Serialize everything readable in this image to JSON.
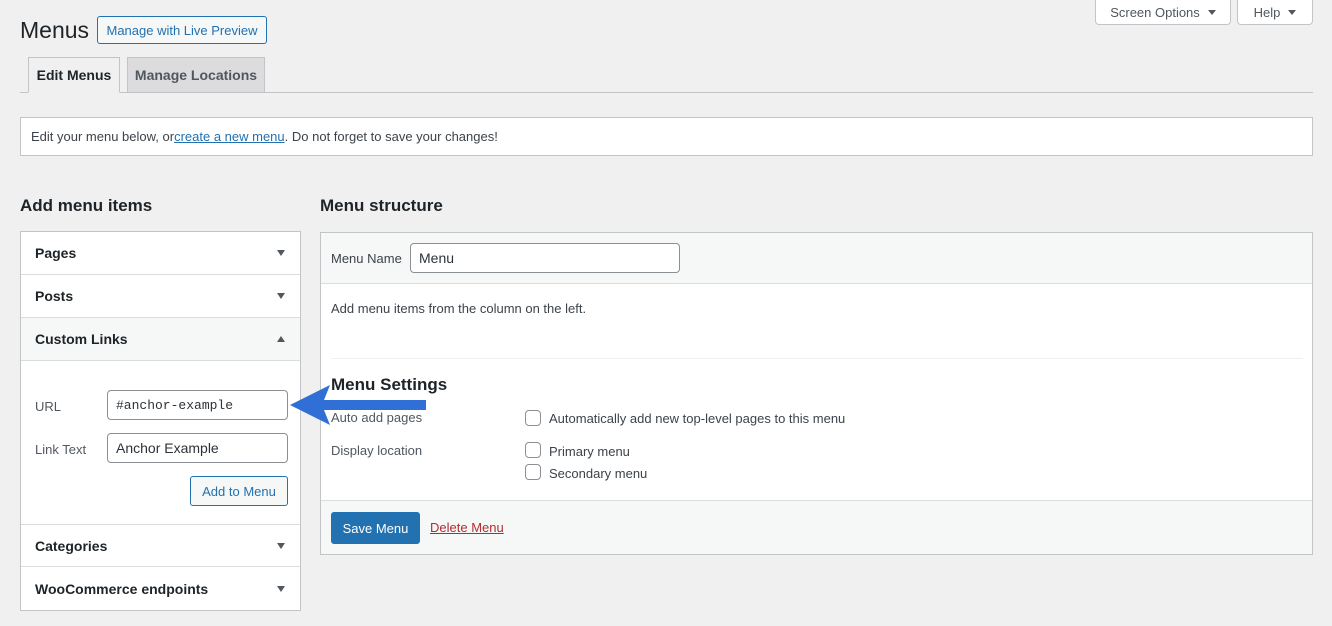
{
  "screen_meta": {
    "screen_options": "Screen Options",
    "help": "Help"
  },
  "header": {
    "title": "Menus",
    "live_preview_button": "Manage with Live Preview"
  },
  "tabs": [
    {
      "label": "Edit Menus",
      "active": true
    },
    {
      "label": "Manage Locations",
      "active": false
    }
  ],
  "notice": {
    "before": "Edit your menu below, or ",
    "link": "create a new menu",
    "after": ". Do not forget to save your changes!"
  },
  "add_items": {
    "heading": "Add menu items",
    "sections": {
      "pages": "Pages",
      "posts": "Posts",
      "custom_links": "Custom Links",
      "categories": "Categories",
      "woocommerce": "WooCommerce endpoints"
    },
    "custom_links_form": {
      "url_label": "URL",
      "url_value": "#anchor-example",
      "link_text_label": "Link Text",
      "link_text_value": "Anchor Example",
      "add_button": "Add to Menu"
    }
  },
  "structure": {
    "heading": "Menu structure",
    "menu_name_label": "Menu Name",
    "menu_name_value": "Menu",
    "empty_text": "Add menu items from the column on the left.",
    "settings_heading": "Menu Settings",
    "auto_add_label": "Auto add pages",
    "auto_add_option": "Automatically add new top-level pages to this menu",
    "display_location_label": "Display location",
    "locations": [
      "Primary menu",
      "Secondary menu"
    ],
    "save_button": "Save Menu",
    "delete_link": "Delete Menu"
  },
  "colors": {
    "primary": "#2271b1",
    "danger": "#b32d2e",
    "background": "#f0f0f1",
    "annotation_arrow": "#2f6fd6"
  }
}
